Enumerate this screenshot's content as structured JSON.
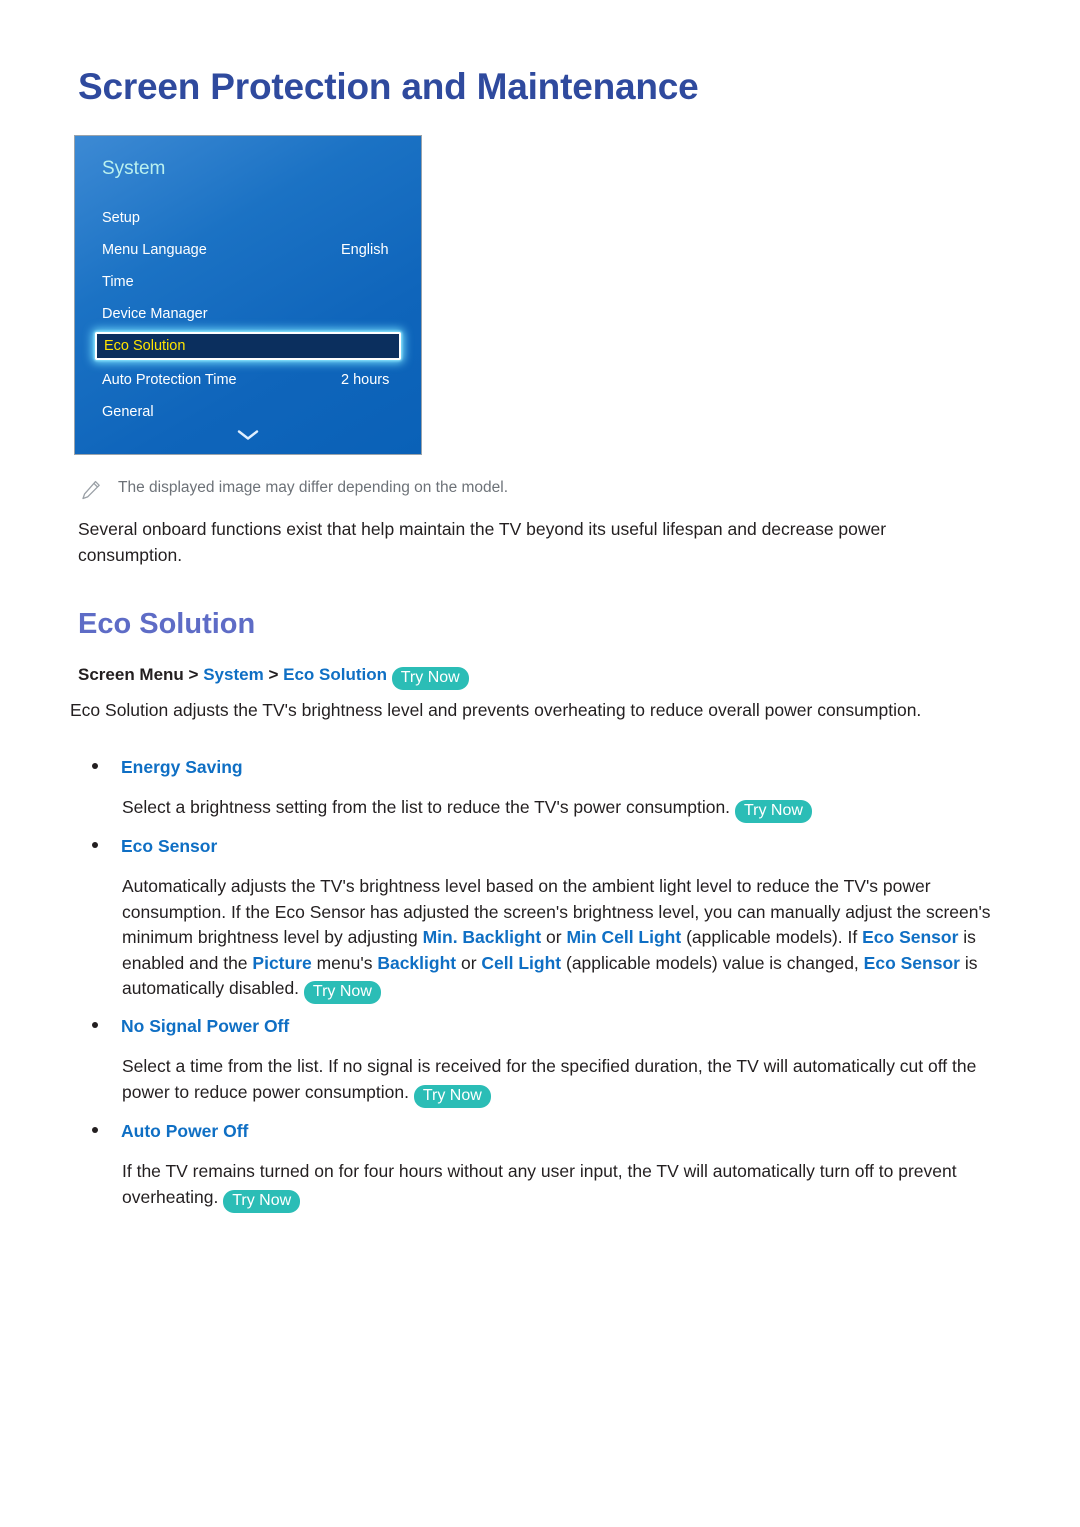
{
  "page": {
    "title": "Screen Protection and Maintenance"
  },
  "tv_menu": {
    "panel_title": "System",
    "scroll_icon": "chevron-down-icon",
    "rows": [
      {
        "label": "Setup",
        "value": "",
        "selected": false
      },
      {
        "label": "Menu Language",
        "value": "English",
        "selected": false
      },
      {
        "label": "Time",
        "value": "",
        "selected": false
      },
      {
        "label": "Device Manager",
        "value": "",
        "selected": false
      },
      {
        "label": "Eco Solution",
        "value": "",
        "selected": true
      },
      {
        "label": "Auto Protection Time",
        "value": "2 hours",
        "selected": false
      },
      {
        "label": "General",
        "value": "",
        "selected": false
      }
    ]
  },
  "note": {
    "icon": "pencil-icon",
    "text": "The displayed image may differ depending on the model."
  },
  "intro": {
    "text": "Several onboard functions exist that help maintain the TV beyond its useful lifespan and decrease power consumption."
  },
  "section": {
    "heading": "Eco Solution",
    "breadcrumb": {
      "root": "Screen Menu",
      "separator": ">",
      "crumb_system": "System",
      "crumb_eco": "Eco Solution",
      "try_now": "Try Now"
    },
    "description": "Eco Solution adjusts the TV's brightness level and prevents overheating to reduce overall power consumption.",
    "items": [
      {
        "title": "Energy Saving",
        "body_1": "Select a brightness setting from the list to reduce the TV's power consumption.",
        "try_now": "Try Now"
      },
      {
        "title": "Eco Sensor",
        "body_1": "Automatically adjusts the TV's brightness level based on the ambient light level to reduce the TV's power consumption. If the Eco Sensor has adjusted the screen's brightness level, you can manually adjust the screen's minimum brightness level by adjusting ",
        "kw_min": "Min. Backlight",
        "body_2": " or ",
        "kw_mincell": "Min Cell Light",
        "body_3": " (applicable models). If ",
        "kw_ecosensor_1": "Eco Sensor",
        "body_4": " is enabled and the ",
        "kw_picture": "Picture",
        "body_5": " menu's ",
        "kw_backlight": "Backlight",
        "body_6": " or ",
        "kw_celllight": "Cell Light",
        "body_7": " (applicable models) value is changed, ",
        "kw_ecosensor_2": "Eco Sensor",
        "body_8": " is automatically disabled.",
        "try_now": "Try Now"
      },
      {
        "title": "No Signal Power Off",
        "body_1": "Select a time from the list. If no signal is received for the specified duration, the TV will automatically cut off the power to reduce power consumption.",
        "try_now": "Try Now"
      },
      {
        "title": "Auto Power Off",
        "body_1": "If the TV remains turned on for four hours without any user input, the TV will automatically turn off to prevent overheating.",
        "try_now": "Try Now"
      }
    ]
  },
  "colors": {
    "title_blue": "#2f4a9e",
    "heading_periwinkle": "#5e6cc6",
    "link_blue": "#0f6fc4",
    "try_now_teal": "#2bbdb6",
    "menu_selected_text": "#ffe400",
    "menu_panel_blue": "#0f65bb"
  }
}
